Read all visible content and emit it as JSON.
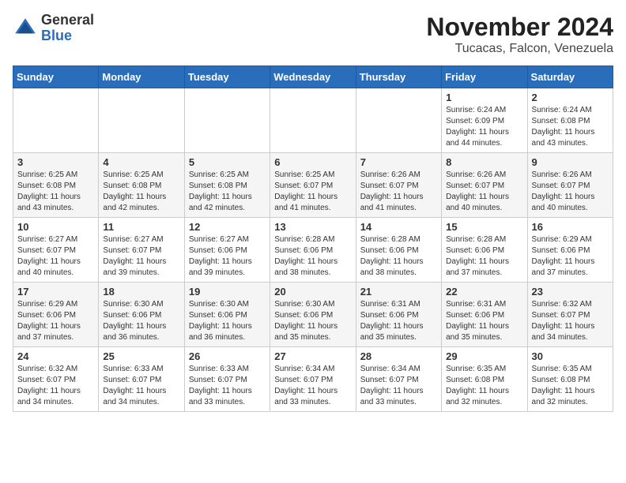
{
  "logo": {
    "general": "General",
    "blue": "Blue"
  },
  "title": "November 2024",
  "subtitle": "Tucacas, Falcon, Venezuela",
  "weekdays": [
    "Sunday",
    "Monday",
    "Tuesday",
    "Wednesday",
    "Thursday",
    "Friday",
    "Saturday"
  ],
  "weeks": [
    [
      {
        "day": "",
        "info": ""
      },
      {
        "day": "",
        "info": ""
      },
      {
        "day": "",
        "info": ""
      },
      {
        "day": "",
        "info": ""
      },
      {
        "day": "",
        "info": ""
      },
      {
        "day": "1",
        "info": "Sunrise: 6:24 AM\nSunset: 6:09 PM\nDaylight: 11 hours and 44 minutes."
      },
      {
        "day": "2",
        "info": "Sunrise: 6:24 AM\nSunset: 6:08 PM\nDaylight: 11 hours and 43 minutes."
      }
    ],
    [
      {
        "day": "3",
        "info": "Sunrise: 6:25 AM\nSunset: 6:08 PM\nDaylight: 11 hours and 43 minutes."
      },
      {
        "day": "4",
        "info": "Sunrise: 6:25 AM\nSunset: 6:08 PM\nDaylight: 11 hours and 42 minutes."
      },
      {
        "day": "5",
        "info": "Sunrise: 6:25 AM\nSunset: 6:08 PM\nDaylight: 11 hours and 42 minutes."
      },
      {
        "day": "6",
        "info": "Sunrise: 6:25 AM\nSunset: 6:07 PM\nDaylight: 11 hours and 41 minutes."
      },
      {
        "day": "7",
        "info": "Sunrise: 6:26 AM\nSunset: 6:07 PM\nDaylight: 11 hours and 41 minutes."
      },
      {
        "day": "8",
        "info": "Sunrise: 6:26 AM\nSunset: 6:07 PM\nDaylight: 11 hours and 40 minutes."
      },
      {
        "day": "9",
        "info": "Sunrise: 6:26 AM\nSunset: 6:07 PM\nDaylight: 11 hours and 40 minutes."
      }
    ],
    [
      {
        "day": "10",
        "info": "Sunrise: 6:27 AM\nSunset: 6:07 PM\nDaylight: 11 hours and 40 minutes."
      },
      {
        "day": "11",
        "info": "Sunrise: 6:27 AM\nSunset: 6:07 PM\nDaylight: 11 hours and 39 minutes."
      },
      {
        "day": "12",
        "info": "Sunrise: 6:27 AM\nSunset: 6:06 PM\nDaylight: 11 hours and 39 minutes."
      },
      {
        "day": "13",
        "info": "Sunrise: 6:28 AM\nSunset: 6:06 PM\nDaylight: 11 hours and 38 minutes."
      },
      {
        "day": "14",
        "info": "Sunrise: 6:28 AM\nSunset: 6:06 PM\nDaylight: 11 hours and 38 minutes."
      },
      {
        "day": "15",
        "info": "Sunrise: 6:28 AM\nSunset: 6:06 PM\nDaylight: 11 hours and 37 minutes."
      },
      {
        "day": "16",
        "info": "Sunrise: 6:29 AM\nSunset: 6:06 PM\nDaylight: 11 hours and 37 minutes."
      }
    ],
    [
      {
        "day": "17",
        "info": "Sunrise: 6:29 AM\nSunset: 6:06 PM\nDaylight: 11 hours and 37 minutes."
      },
      {
        "day": "18",
        "info": "Sunrise: 6:30 AM\nSunset: 6:06 PM\nDaylight: 11 hours and 36 minutes."
      },
      {
        "day": "19",
        "info": "Sunrise: 6:30 AM\nSunset: 6:06 PM\nDaylight: 11 hours and 36 minutes."
      },
      {
        "day": "20",
        "info": "Sunrise: 6:30 AM\nSunset: 6:06 PM\nDaylight: 11 hours and 35 minutes."
      },
      {
        "day": "21",
        "info": "Sunrise: 6:31 AM\nSunset: 6:06 PM\nDaylight: 11 hours and 35 minutes."
      },
      {
        "day": "22",
        "info": "Sunrise: 6:31 AM\nSunset: 6:06 PM\nDaylight: 11 hours and 35 minutes."
      },
      {
        "day": "23",
        "info": "Sunrise: 6:32 AM\nSunset: 6:07 PM\nDaylight: 11 hours and 34 minutes."
      }
    ],
    [
      {
        "day": "24",
        "info": "Sunrise: 6:32 AM\nSunset: 6:07 PM\nDaylight: 11 hours and 34 minutes."
      },
      {
        "day": "25",
        "info": "Sunrise: 6:33 AM\nSunset: 6:07 PM\nDaylight: 11 hours and 34 minutes."
      },
      {
        "day": "26",
        "info": "Sunrise: 6:33 AM\nSunset: 6:07 PM\nDaylight: 11 hours and 33 minutes."
      },
      {
        "day": "27",
        "info": "Sunrise: 6:34 AM\nSunset: 6:07 PM\nDaylight: 11 hours and 33 minutes."
      },
      {
        "day": "28",
        "info": "Sunrise: 6:34 AM\nSunset: 6:07 PM\nDaylight: 11 hours and 33 minutes."
      },
      {
        "day": "29",
        "info": "Sunrise: 6:35 AM\nSunset: 6:08 PM\nDaylight: 11 hours and 32 minutes."
      },
      {
        "day": "30",
        "info": "Sunrise: 6:35 AM\nSunset: 6:08 PM\nDaylight: 11 hours and 32 minutes."
      }
    ]
  ]
}
